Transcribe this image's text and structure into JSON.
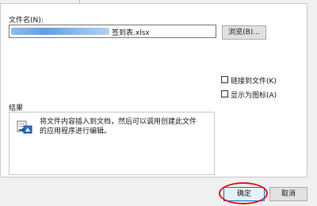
{
  "file": {
    "label": "文件名(N):",
    "value": "签到表.xlsx"
  },
  "browse_label": "浏览(B)...",
  "options": {
    "link": "链接到文件(K)",
    "icon": "显示为图标(A)"
  },
  "result": {
    "label": "结果",
    "text": "将文件内容插入到文档，然后可以调用创建此文件的应用程序进行编辑。"
  },
  "buttons": {
    "ok": "确定",
    "cancel": "取消"
  },
  "colors": {
    "highlight_circle": "#e0191e",
    "redaction": "#4e94dd"
  }
}
